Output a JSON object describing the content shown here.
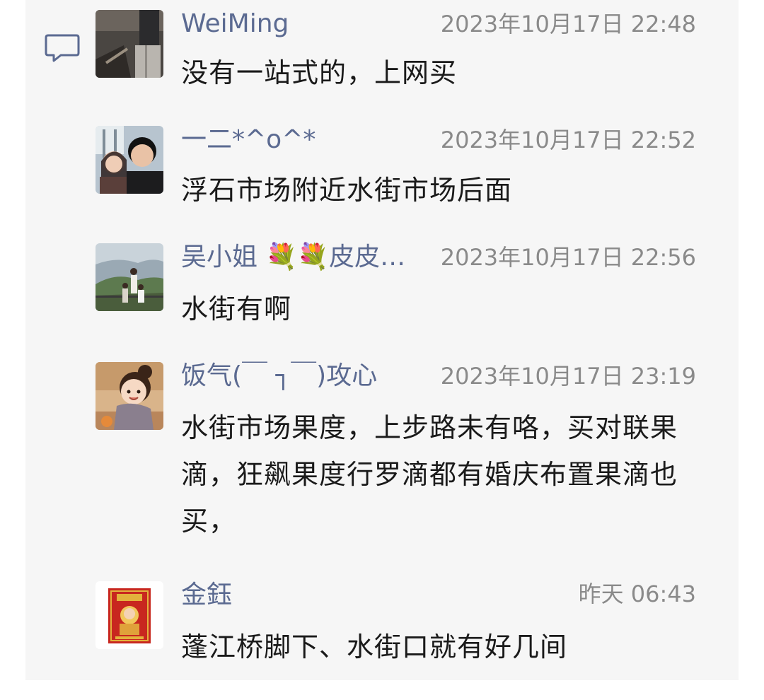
{
  "comments": [
    {
      "name": "WeiMing",
      "time": "2023年10月17日 22:48",
      "text": "没有一站式的，上网买",
      "avatar": "photo-street-avatar"
    },
    {
      "name": "一二*^o^*",
      "time": "2023年10月17日 22:52",
      "text": "浮石市场附近水街市场后面",
      "avatar": "photo-couple-avatar"
    },
    {
      "name": "吴小姐 💐💐皮皮…",
      "time": "2023年10月17日 22:56",
      "text": "水街有啊",
      "avatar": "photo-family-avatar"
    },
    {
      "name": "饭气(￣ ┐￣)攻心",
      "time": "2023年10月17日 23:19",
      "text": "水街市场果度，上步路未有咯，买对联果滴，狂飙果度行罗滴都有婚庆布置果滴也买，",
      "avatar": "cartoon-girl-avatar"
    },
    {
      "name": "金鈺",
      "time": "昨天 06:43",
      "text": "蓬江桥脚下、水街口就有好几间",
      "avatar": "red-card-avatar"
    }
  ],
  "icons": {
    "comment": "speech-bubble-icon"
  },
  "colors": {
    "name": "#5b6a91",
    "time": "#8a8a8a",
    "text": "#1a1a1a",
    "panel": "#f6f6f6",
    "icon": "#5b6a91"
  }
}
